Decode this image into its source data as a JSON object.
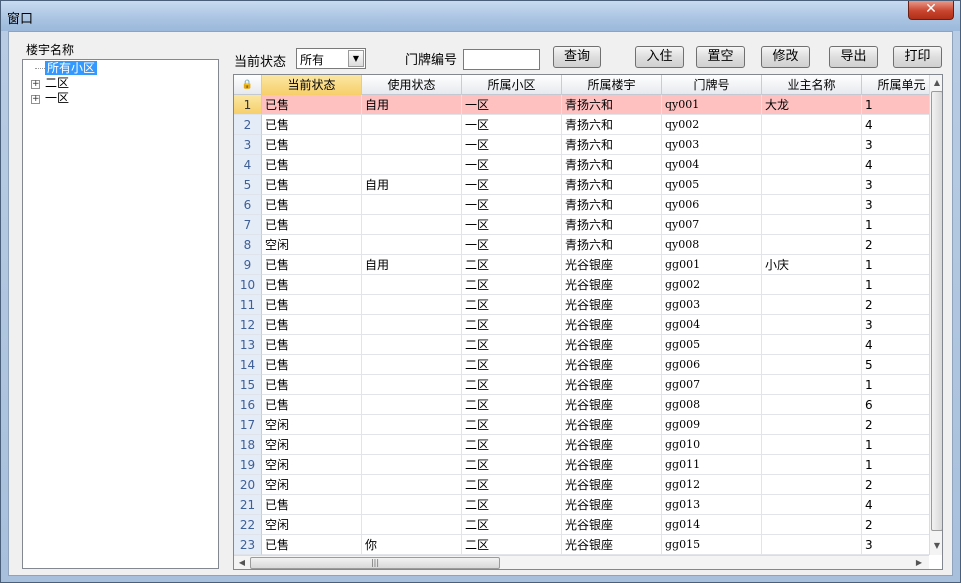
{
  "window": {
    "title": "窗口",
    "close_glyph": "✕"
  },
  "tree": {
    "label": "楼宇名称",
    "root": "所有小区",
    "nodes": [
      {
        "label": "二区",
        "expander": "+"
      },
      {
        "label": "一区",
        "expander": "+"
      }
    ]
  },
  "toolbar": {
    "status_label": "当前状态",
    "status_value": "所有",
    "door_label": "门牌编号",
    "door_value": "",
    "query": "查询",
    "checkin": "入住",
    "vacate": "置空",
    "modify": "修改",
    "export": "导出",
    "print": "打印"
  },
  "grid": {
    "columns": [
      "当前状态",
      "使用状态",
      "所属小区",
      "所属楼宇",
      "门牌号",
      "业主名称",
      "所属单元"
    ],
    "rows": [
      {
        "n": "1",
        "c": [
          "已售",
          "自用",
          "一区",
          "青扬六和",
          "qy001",
          "大龙",
          "1"
        ]
      },
      {
        "n": "2",
        "c": [
          "已售",
          "",
          "一区",
          "青扬六和",
          "qy002",
          "",
          "4"
        ]
      },
      {
        "n": "3",
        "c": [
          "已售",
          "",
          "一区",
          "青扬六和",
          "qy003",
          "",
          "3"
        ]
      },
      {
        "n": "4",
        "c": [
          "已售",
          "",
          "一区",
          "青扬六和",
          "qy004",
          "",
          "4"
        ]
      },
      {
        "n": "5",
        "c": [
          "已售",
          "自用",
          "一区",
          "青扬六和",
          "qy005",
          "",
          "3"
        ]
      },
      {
        "n": "6",
        "c": [
          "已售",
          "",
          "一区",
          "青扬六和",
          "qy006",
          "",
          "3"
        ]
      },
      {
        "n": "7",
        "c": [
          "已售",
          "",
          "一区",
          "青扬六和",
          "qy007",
          "",
          "1"
        ]
      },
      {
        "n": "8",
        "c": [
          "空闲",
          "",
          "一区",
          "青扬六和",
          "qy008",
          "",
          "2"
        ]
      },
      {
        "n": "9",
        "c": [
          "已售",
          "自用",
          "二区",
          "光谷银座",
          "gg001",
          "小庆",
          "1"
        ]
      },
      {
        "n": "10",
        "c": [
          "已售",
          "",
          "二区",
          "光谷银座",
          "gg002",
          "",
          "1"
        ]
      },
      {
        "n": "11",
        "c": [
          "已售",
          "",
          "二区",
          "光谷银座",
          "gg003",
          "",
          "2"
        ]
      },
      {
        "n": "12",
        "c": [
          "已售",
          "",
          "二区",
          "光谷银座",
          "gg004",
          "",
          "3"
        ]
      },
      {
        "n": "13",
        "c": [
          "已售",
          "",
          "二区",
          "光谷银座",
          "gg005",
          "",
          "4"
        ]
      },
      {
        "n": "14",
        "c": [
          "已售",
          "",
          "二区",
          "光谷银座",
          "gg006",
          "",
          "5"
        ]
      },
      {
        "n": "15",
        "c": [
          "已售",
          "",
          "二区",
          "光谷银座",
          "gg007",
          "",
          "1"
        ]
      },
      {
        "n": "16",
        "c": [
          "已售",
          "",
          "二区",
          "光谷银座",
          "gg008",
          "",
          "6"
        ]
      },
      {
        "n": "17",
        "c": [
          "空闲",
          "",
          "二区",
          "光谷银座",
          "gg009",
          "",
          "2"
        ]
      },
      {
        "n": "18",
        "c": [
          "空闲",
          "",
          "二区",
          "光谷银座",
          "gg010",
          "",
          "1"
        ]
      },
      {
        "n": "19",
        "c": [
          "空闲",
          "",
          "二区",
          "光谷银座",
          "gg011",
          "",
          "1"
        ]
      },
      {
        "n": "20",
        "c": [
          "空闲",
          "",
          "二区",
          "光谷银座",
          "gg012",
          "",
          "2"
        ]
      },
      {
        "n": "21",
        "c": [
          "已售",
          "",
          "二区",
          "光谷银座",
          "gg013",
          "",
          "4"
        ]
      },
      {
        "n": "22",
        "c": [
          "空闲",
          "",
          "二区",
          "光谷银座",
          "gg014",
          "",
          "2"
        ]
      },
      {
        "n": "23",
        "c": [
          "已售",
          "你",
          "二区",
          "光谷银座",
          "gg015",
          "",
          "3"
        ]
      }
    ]
  },
  "colors": {
    "selected_row": "#ffc0c0",
    "active_header": "#f6cf6a",
    "tree_highlight": "#3399ff"
  }
}
